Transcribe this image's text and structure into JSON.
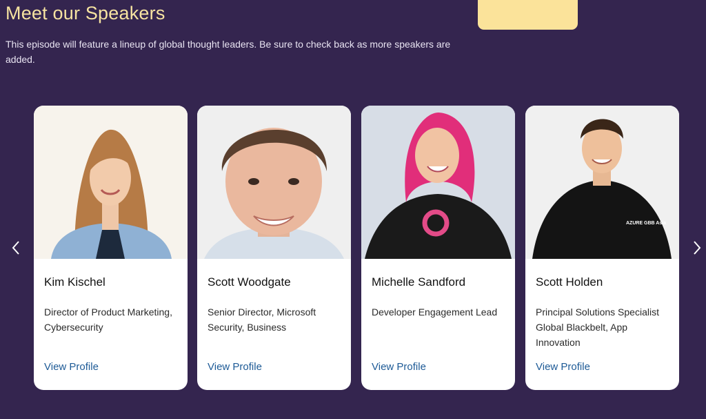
{
  "header": {
    "title": "Meet our Speakers",
    "intro": "This episode will feature a lineup of global thought leaders. Be sure to check back as more speakers are added."
  },
  "carousel": {
    "prev_icon": "chevron-left-icon",
    "next_icon": "chevron-right-icon"
  },
  "speakers": [
    {
      "name": "Kim Kischel",
      "title": "Director of Product Marketing, Cybersecurity",
      "link": "View Profile"
    },
    {
      "name": "Scott Woodgate",
      "title": "Senior Director, Microsoft Security, Business",
      "link": "View Profile"
    },
    {
      "name": "Michelle Sandford",
      "title": "Developer Engagement Lead",
      "link": "View Profile"
    },
    {
      "name": "Scott Holden",
      "title": "Principal Solutions Specialist Global Blackbelt, App Innovation",
      "link": "View Profile",
      "shirt_print": "AZURE GBB Asia"
    }
  ],
  "colors": {
    "background": "#34254f",
    "title": "#f6e3a1",
    "accent_block": "#fbe39a",
    "link": "#1d5a96"
  }
}
